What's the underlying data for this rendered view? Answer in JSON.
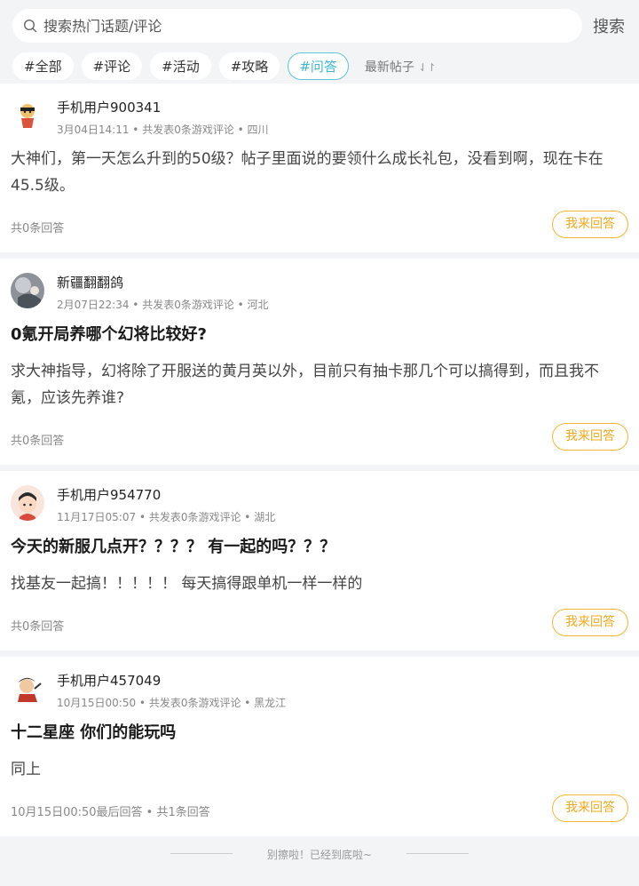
{
  "search": {
    "placeholder": "搜索热门话题/评论",
    "button_label": "搜索"
  },
  "tabs": [
    {
      "label": "#全部",
      "active": false
    },
    {
      "label": "#评论",
      "active": false
    },
    {
      "label": "#活动",
      "active": false
    },
    {
      "label": "#攻略",
      "active": false
    },
    {
      "label": "#问答",
      "active": true
    }
  ],
  "sort": {
    "label": "最新帖子",
    "icon": "sort-arrows-icon"
  },
  "posts": [
    {
      "username": "手机用户900341",
      "meta": "3月04日14:11 • 共发表0条游戏评论 • 四川",
      "title": "",
      "body": "大神们，第一天怎么升到的50级？帖子里面说的要领什么成长礼包，没看到啊，现在卡在45.5级。",
      "footer": "共0条回答",
      "answer_label": "我来回答"
    },
    {
      "username": "新疆翻翻鸽",
      "meta": "2月07日22:34 • 共发表0条游戏评论 • 河北",
      "title": "0氪开局养哪个幻将比较好?",
      "body": "求大神指导，幻将除了开服送的黄月英以外，目前只有抽卡那几个可以搞得到，而且我不氪，应该先养谁?",
      "footer": "共0条回答",
      "answer_label": "我来回答"
    },
    {
      "username": "手机用户954770",
      "meta": "11月17日05:07 • 共发表0条游戏评论 • 湖北",
      "title": "今天的新服几点开？？？？ 有一起的吗？？？",
      "body": "找基友一起搞！！！！！ 每天搞得跟单机一样一样的",
      "footer": "共0条回答",
      "answer_label": "我来回答"
    },
    {
      "username": "手机用户457049",
      "meta": "10月15日00:50 • 共发表0条游戏评论 • 黑龙江",
      "title": "十二星座 你们的能玩吗",
      "body": "同上",
      "footer": "10月15日00:50最后回答 • 共1条回答",
      "answer_label": "我来回答"
    }
  ],
  "end_text": "别擦啦！已经到底啦~"
}
